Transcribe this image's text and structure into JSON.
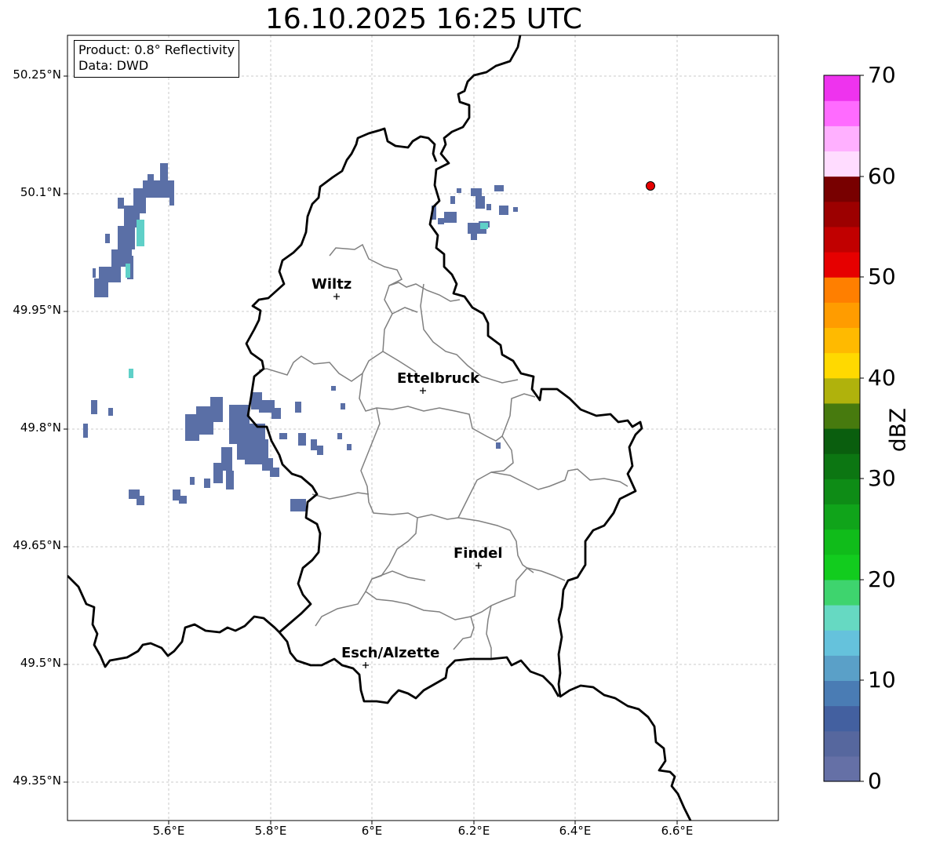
{
  "title": "16.10.2025 16:25 UTC",
  "info": {
    "product": "Product: 0.8° Reflectivity",
    "data": "Data: DWD"
  },
  "lat_labels": [
    "50.25°N",
    "50.1°N",
    "49.95°N",
    "49.8°N",
    "49.65°N",
    "49.5°N",
    "49.35°N"
  ],
  "lon_labels": [
    "5.6°E",
    "5.8°E",
    "6°E",
    "6.2°E",
    "6.4°E",
    "6.6°E"
  ],
  "cities": [
    {
      "name": "Wiltz",
      "lon": 5.93,
      "lat": 49.969
    },
    {
      "name": "Ettelbruck",
      "lon": 6.1,
      "lat": 49.849
    },
    {
      "name": "Findel",
      "lon": 6.21,
      "lat": 49.626
    },
    {
      "name": "Esch/Alzette",
      "lon": 5.99,
      "lat": 49.499
    }
  ],
  "radar_site": {
    "lon": 6.547,
    "lat": 50.11,
    "color": "#e60000"
  },
  "colorbar": {
    "label": "dBZ",
    "ticks": [
      "0",
      "10",
      "20",
      "30",
      "40",
      "50",
      "60",
      "70"
    ],
    "colors": [
      "#6570a6",
      "#56679e",
      "#4360a0",
      "#4a7cb4",
      "#5aa0c8",
      "#65c2dc",
      "#66d9c2",
      "#3ed46e",
      "#12cc1e",
      "#10bc1a",
      "#10a41a",
      "#0e8c16",
      "#0c7612",
      "#0a5e0e",
      "#477a0e",
      "#b0b20c",
      "#ffd900",
      "#ffba00",
      "#ff9c00",
      "#ff7f00",
      "#e60000",
      "#c10000",
      "#9c0000",
      "#780000",
      "#ffdcff",
      "#ffb0ff",
      "#ff6bff",
      "#ee33ee"
    ]
  },
  "colors": {
    "border": "#000000",
    "canton": "#808080",
    "grid": "#bbbbbb",
    "echo_weak": "#5a6fa6",
    "echo_light": "#5fd0c8"
  }
}
